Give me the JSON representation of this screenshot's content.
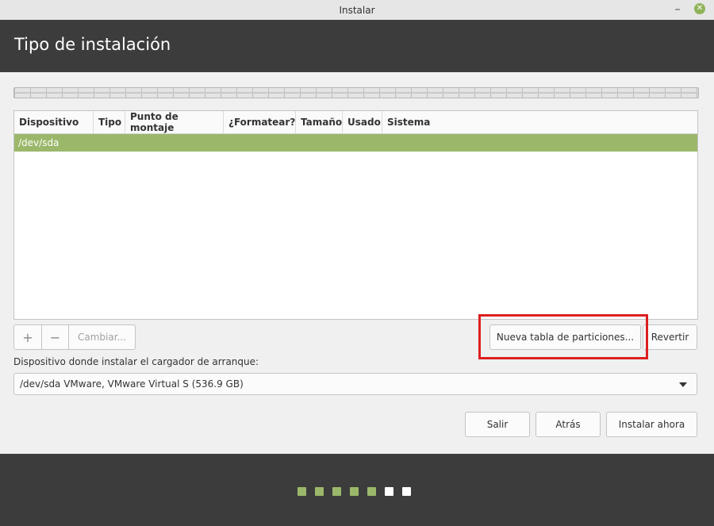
{
  "window": {
    "title": "Instalar",
    "minimize_icon": "minimize-icon",
    "minimize_glyph": "–",
    "close_icon": "close-icon",
    "close_glyph": "✕",
    "close_color": "#8fb35a"
  },
  "header": {
    "title": "Tipo de instalación"
  },
  "table": {
    "columns": [
      "Dispositivo",
      "Tipo",
      "Punto de montaje",
      "¿Formatear?",
      "Tamaño",
      "Usado",
      "Sistema"
    ],
    "rows": [
      {
        "device": "/dev/sda",
        "selected": true
      }
    ],
    "selected_color": "#9bb86a"
  },
  "actions": {
    "add_label": "+",
    "remove_label": "−",
    "change_label": "Cambiar...",
    "new_table_label": "Nueva tabla de particiones...",
    "revert_label": "Revertir"
  },
  "bootloader": {
    "label": "Dispositivo donde instalar el cargador de arranque:",
    "selected": "/dev/sda VMware, VMware Virtual S (536.9 GB)"
  },
  "buttons": {
    "quit": "Salir",
    "back": "Atrás",
    "install": "Instalar ahora"
  },
  "progress": {
    "total_steps": 7,
    "completed_steps": 5,
    "completed_color": "#9bb86a",
    "pending_color": "#ffffff"
  },
  "highlight_color": "#dd1f1f"
}
